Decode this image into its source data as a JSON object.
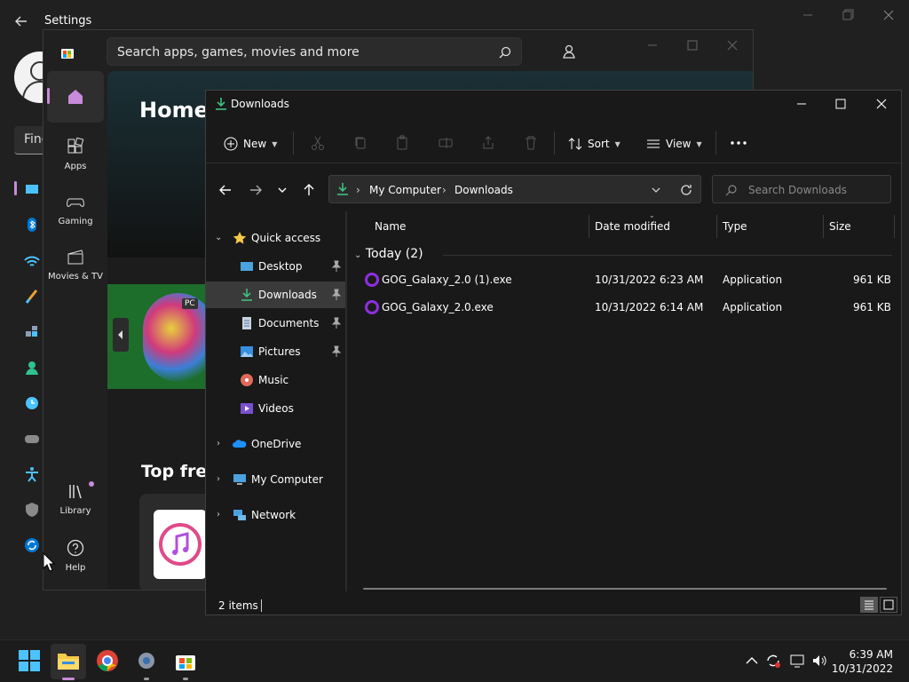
{
  "settings": {
    "title": "Settings",
    "find_placeholder": "Find"
  },
  "store": {
    "search_placeholder": "Search apps, games, movies and more",
    "home_title": "Home",
    "top_free": "Top free",
    "banner_badge": "PC",
    "nav": {
      "apps": "Apps",
      "gaming": "Gaming",
      "movies": "Movies & TV",
      "library": "Library",
      "help": "Help"
    }
  },
  "explorer": {
    "title": "Downloads",
    "toolbar": {
      "new": "New",
      "sort": "Sort",
      "view": "View"
    },
    "breadcrumb": [
      "My Computer",
      "Downloads"
    ],
    "search_placeholder": "Search Downloads",
    "tree": {
      "quick_access": "Quick access",
      "desktop": "Desktop",
      "downloads": "Downloads",
      "documents": "Documents",
      "pictures": "Pictures",
      "music": "Music",
      "videos": "Videos",
      "onedrive": "OneDrive",
      "my_computer": "My Computer",
      "network": "Network"
    },
    "columns": {
      "name": "Name",
      "date": "Date modified",
      "type": "Type",
      "size": "Size"
    },
    "group": "Today (2)",
    "files": [
      {
        "name": "GOG_Galaxy_2.0 (1).exe",
        "date": "10/31/2022 6:23 AM",
        "type": "Application",
        "size": "961 KB"
      },
      {
        "name": "GOG_Galaxy_2.0.exe",
        "date": "10/31/2022 6:14 AM",
        "type": "Application",
        "size": "961 KB"
      }
    ],
    "status": "2 items"
  },
  "taskbar": {
    "time": "6:39 AM",
    "date": "10/31/2022"
  },
  "colors": {
    "accent": "#c88bda",
    "download_green": "#3fbf7f",
    "gog_purple": "#8e2ee0"
  }
}
